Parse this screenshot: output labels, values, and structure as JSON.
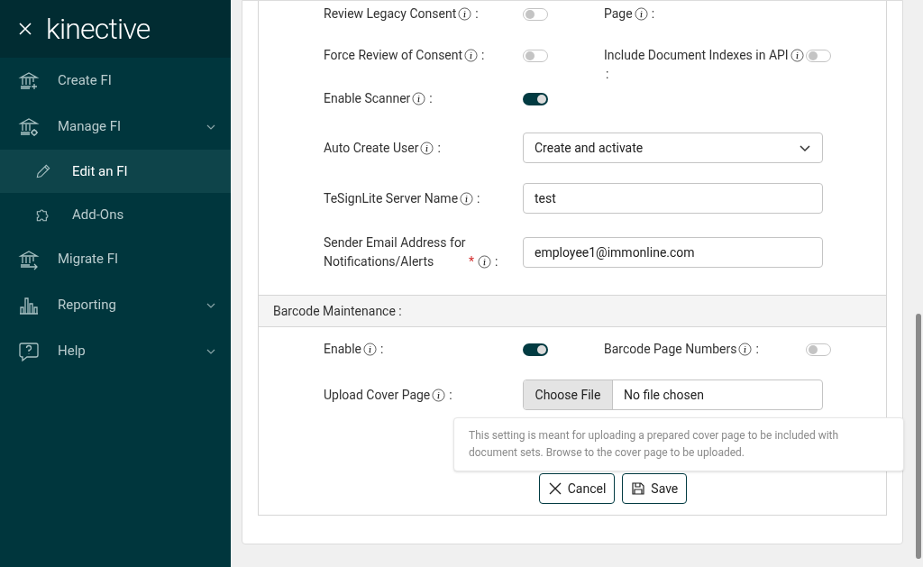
{
  "sidebar": {
    "logo": "kinective",
    "items": [
      {
        "label": "Create FI"
      },
      {
        "label": "Manage FI",
        "has_submenu": true,
        "expanded": true,
        "children": [
          {
            "label": "Edit an FI",
            "selected": true
          },
          {
            "label": "Add-Ons",
            "selected": false
          }
        ]
      },
      {
        "label": "Migrate FI"
      },
      {
        "label": "Reporting",
        "has_submenu": true,
        "expanded": false
      },
      {
        "label": "Help",
        "has_submenu": true,
        "expanded": false
      }
    ]
  },
  "form": {
    "rows": [
      {
        "fields": [
          {
            "kind": "toggle",
            "label": "Review Legacy Consent",
            "colon": ":",
            "on": false
          },
          {
            "kind": "label_only",
            "label": "Page",
            "colon": ":"
          }
        ]
      },
      {
        "fields": [
          {
            "kind": "toggle",
            "label": "Force Review of Consent",
            "colon": ":",
            "on": false
          },
          {
            "kind": "toggle",
            "label": "Include Document Indexes in API",
            "colon": ":",
            "on": false
          }
        ]
      },
      {
        "fields": [
          {
            "kind": "toggle",
            "label": "Enable Scanner",
            "colon": ":",
            "on": true
          }
        ]
      },
      {
        "fields": [
          {
            "kind": "select",
            "label": "Auto Create User",
            "colon": ":",
            "value": "Create and activate"
          }
        ]
      },
      {
        "fields": [
          {
            "kind": "text",
            "label": "TeSignLite Server Name",
            "colon": ":",
            "value": "test"
          }
        ]
      },
      {
        "fields": [
          {
            "kind": "text",
            "label": "Sender Email Address for Notifications/Alerts",
            "required_mark": "*",
            "colon": ":",
            "value": "employee1@immonline.com"
          }
        ]
      }
    ],
    "section": {
      "title": "Barcode Maintenance :",
      "rows": [
        {
          "fields": [
            {
              "kind": "toggle",
              "label": "Enable",
              "colon": ":",
              "on": true
            },
            {
              "kind": "toggle",
              "label": "Barcode Page Numbers",
              "colon": ":",
              "on": false
            }
          ]
        },
        {
          "fields": [
            {
              "kind": "file",
              "label": "Upload Cover Page",
              "colon": ":",
              "button": "Choose File",
              "value": "No file chosen",
              "tooltip": "This setting is meant for uploading a prepared cover page to be included with document sets. Browse to the cover page to be uploaded."
            }
          ]
        }
      ]
    },
    "buttons": [
      {
        "kind": "cancel",
        "label": "Cancel"
      },
      {
        "kind": "save",
        "label": "Save"
      }
    ]
  }
}
